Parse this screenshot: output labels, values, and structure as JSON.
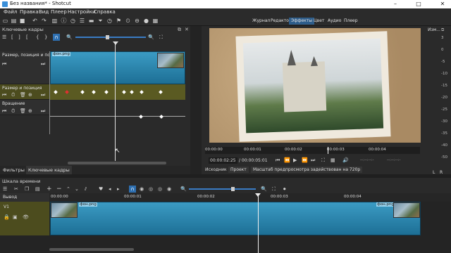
{
  "window": {
    "title": "Без названия* - Shotcut"
  },
  "menu": [
    "Файл",
    "Правка",
    "Вид",
    "Плеер",
    "Настройки",
    "Справка"
  ],
  "view_tabs": [
    "Журнал",
    "Редактор",
    "Эффекты",
    "Цвет",
    "Аудио",
    "Плеер"
  ],
  "active_view_tab": "Эффекты",
  "keyframes_panel": {
    "title": "Ключевые кадры",
    "clip_label": "фон.png",
    "param1": "Размер, позиция и по...",
    "param2": "Размер и позиция",
    "param3": "Вращение"
  },
  "left_tabs": [
    "Фильтры",
    "Ключевые кадры"
  ],
  "side_panel": {
    "title": "Изм...",
    "levels": [
      "3",
      "0",
      "-5",
      "-10",
      "-15",
      "-20",
      "-25",
      "-30",
      "-35",
      "-40",
      "-50"
    ],
    "lr": [
      "L",
      "R"
    ]
  },
  "player": {
    "ruler": [
      "00:00:00",
      "00:00:01",
      "00:00:02",
      "00:00:03",
      "00:00:04"
    ],
    "current_time": "00:00:02:25",
    "total_time": "/ 00:00:05:01",
    "in_point": "--:--:--:-",
    "out_point": "--:--:--:-",
    "tabs": [
      "Исходник",
      "Проект"
    ],
    "status": "Масштаб предпросмотра задействован на 720р"
  },
  "timeline": {
    "title": "Шкала времени",
    "output_label": "Вывод",
    "track_label": "V1",
    "ruler": [
      "00:00:00",
      "00:00:01",
      "00:00:02",
      "00:00:03",
      "00:00:04"
    ],
    "clip_label": "фон.png"
  },
  "colors": {
    "accent": "#2e5d8a",
    "clip": "#1d6f95",
    "kf_track": "#4c4c1e"
  }
}
